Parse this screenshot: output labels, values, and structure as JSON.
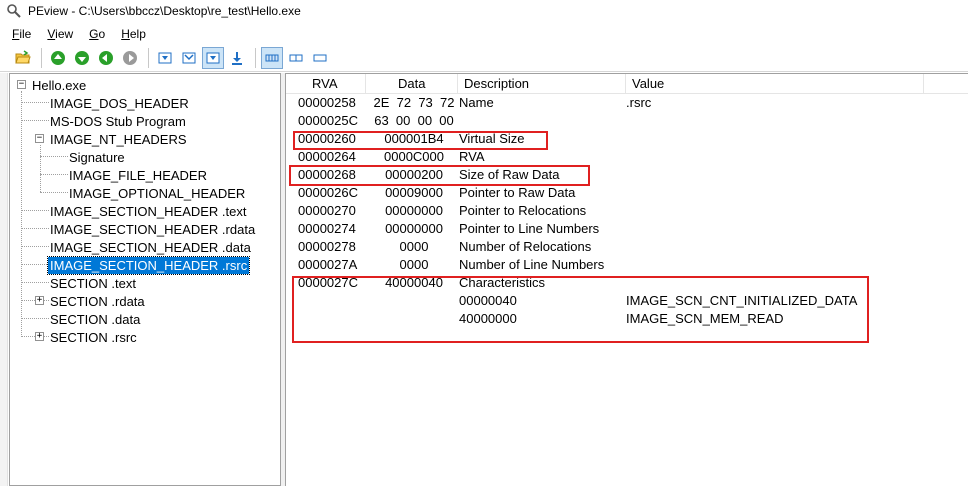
{
  "window": {
    "title": "PEview - C:\\Users\\bbccz\\Desktop\\re_test\\Hello.exe",
    "icon": "magnifier-icon"
  },
  "menu": [
    {
      "underline": "F",
      "rest": "ile"
    },
    {
      "underline": "V",
      "rest": "iew"
    },
    {
      "underline": "G",
      "rest": "o"
    },
    {
      "underline": "H",
      "rest": "elp"
    }
  ],
  "toolbar": {
    "icons": [
      "open-folder-icon",
      "go-up-icon",
      "go-down-icon",
      "go-back-icon",
      "go-forward-icon",
      "view-byte-icon",
      "view-word-icon",
      "view-dword-icon",
      "view-qword-icon",
      "view-list-icon",
      "view-raw-icon",
      "view-hex-icon"
    ],
    "colors": {
      "green": "#2aa02a",
      "gray": "#9a9a9a",
      "blue": "#1f6fc5",
      "pressed": "#cce4f7"
    }
  },
  "tree": {
    "root": "Hello.exe",
    "items": [
      {
        "label": "IMAGE_DOS_HEADER",
        "level": 1
      },
      {
        "label": "MS-DOS Stub Program",
        "level": 1
      },
      {
        "label": "IMAGE_NT_HEADERS",
        "level": 1,
        "expander": "-"
      },
      {
        "label": "Signature",
        "level": 2
      },
      {
        "label": "IMAGE_FILE_HEADER",
        "level": 2
      },
      {
        "label": "IMAGE_OPTIONAL_HEADER",
        "level": 2
      },
      {
        "label": "IMAGE_SECTION_HEADER .text",
        "level": 1
      },
      {
        "label": "IMAGE_SECTION_HEADER .rdata",
        "level": 1
      },
      {
        "label": "IMAGE_SECTION_HEADER .data",
        "level": 1
      },
      {
        "label": "IMAGE_SECTION_HEADER .rsrc",
        "level": 1,
        "selected": true
      },
      {
        "label": "SECTION .text",
        "level": 1
      },
      {
        "label": "SECTION .rdata",
        "level": 1,
        "expander": "+"
      },
      {
        "label": "SECTION .data",
        "level": 1
      },
      {
        "label": "SECTION .rsrc",
        "level": 1,
        "expander": "+"
      }
    ]
  },
  "list": {
    "columns": [
      "RVA",
      "Data",
      "Description",
      "Value"
    ],
    "rows": [
      {
        "rva": "00000258",
        "data": "2E  72  73  72",
        "desc": "Name",
        "value": ".rsrc"
      },
      {
        "rva": "0000025C",
        "data": "63  00  00  00",
        "desc": "",
        "value": ""
      },
      {
        "rva": "00000260",
        "data": "000001B4",
        "desc": "Virtual Size",
        "value": ""
      },
      {
        "rva": "00000264",
        "data": "0000C000",
        "desc": "RVA",
        "value": ""
      },
      {
        "rva": "00000268",
        "data": "00000200",
        "desc": "Size of Raw Data",
        "value": ""
      },
      {
        "rva": "0000026C",
        "data": "00009000",
        "desc": "Pointer to Raw Data",
        "value": ""
      },
      {
        "rva": "00000270",
        "data": "00000000",
        "desc": "Pointer to Relocations",
        "value": ""
      },
      {
        "rva": "00000274",
        "data": "00000000",
        "desc": "Pointer to Line Numbers",
        "value": ""
      },
      {
        "rva": "00000278",
        "data": "0000",
        "desc": "Number of Relocations",
        "value": ""
      },
      {
        "rva": "0000027A",
        "data": "0000",
        "desc": "Number of Line Numbers",
        "value": ""
      },
      {
        "rva": "0000027C",
        "data": "40000040",
        "desc": "Characteristics",
        "value": ""
      },
      {
        "rva": "",
        "data": "",
        "desc": "00000040",
        "value": "IMAGE_SCN_CNT_INITIALIZED_DATA"
      },
      {
        "rva": "",
        "data": "",
        "desc": "40000000",
        "value": "IMAGE_SCN_MEM_READ"
      }
    ],
    "highlight_color": "#e02020"
  }
}
